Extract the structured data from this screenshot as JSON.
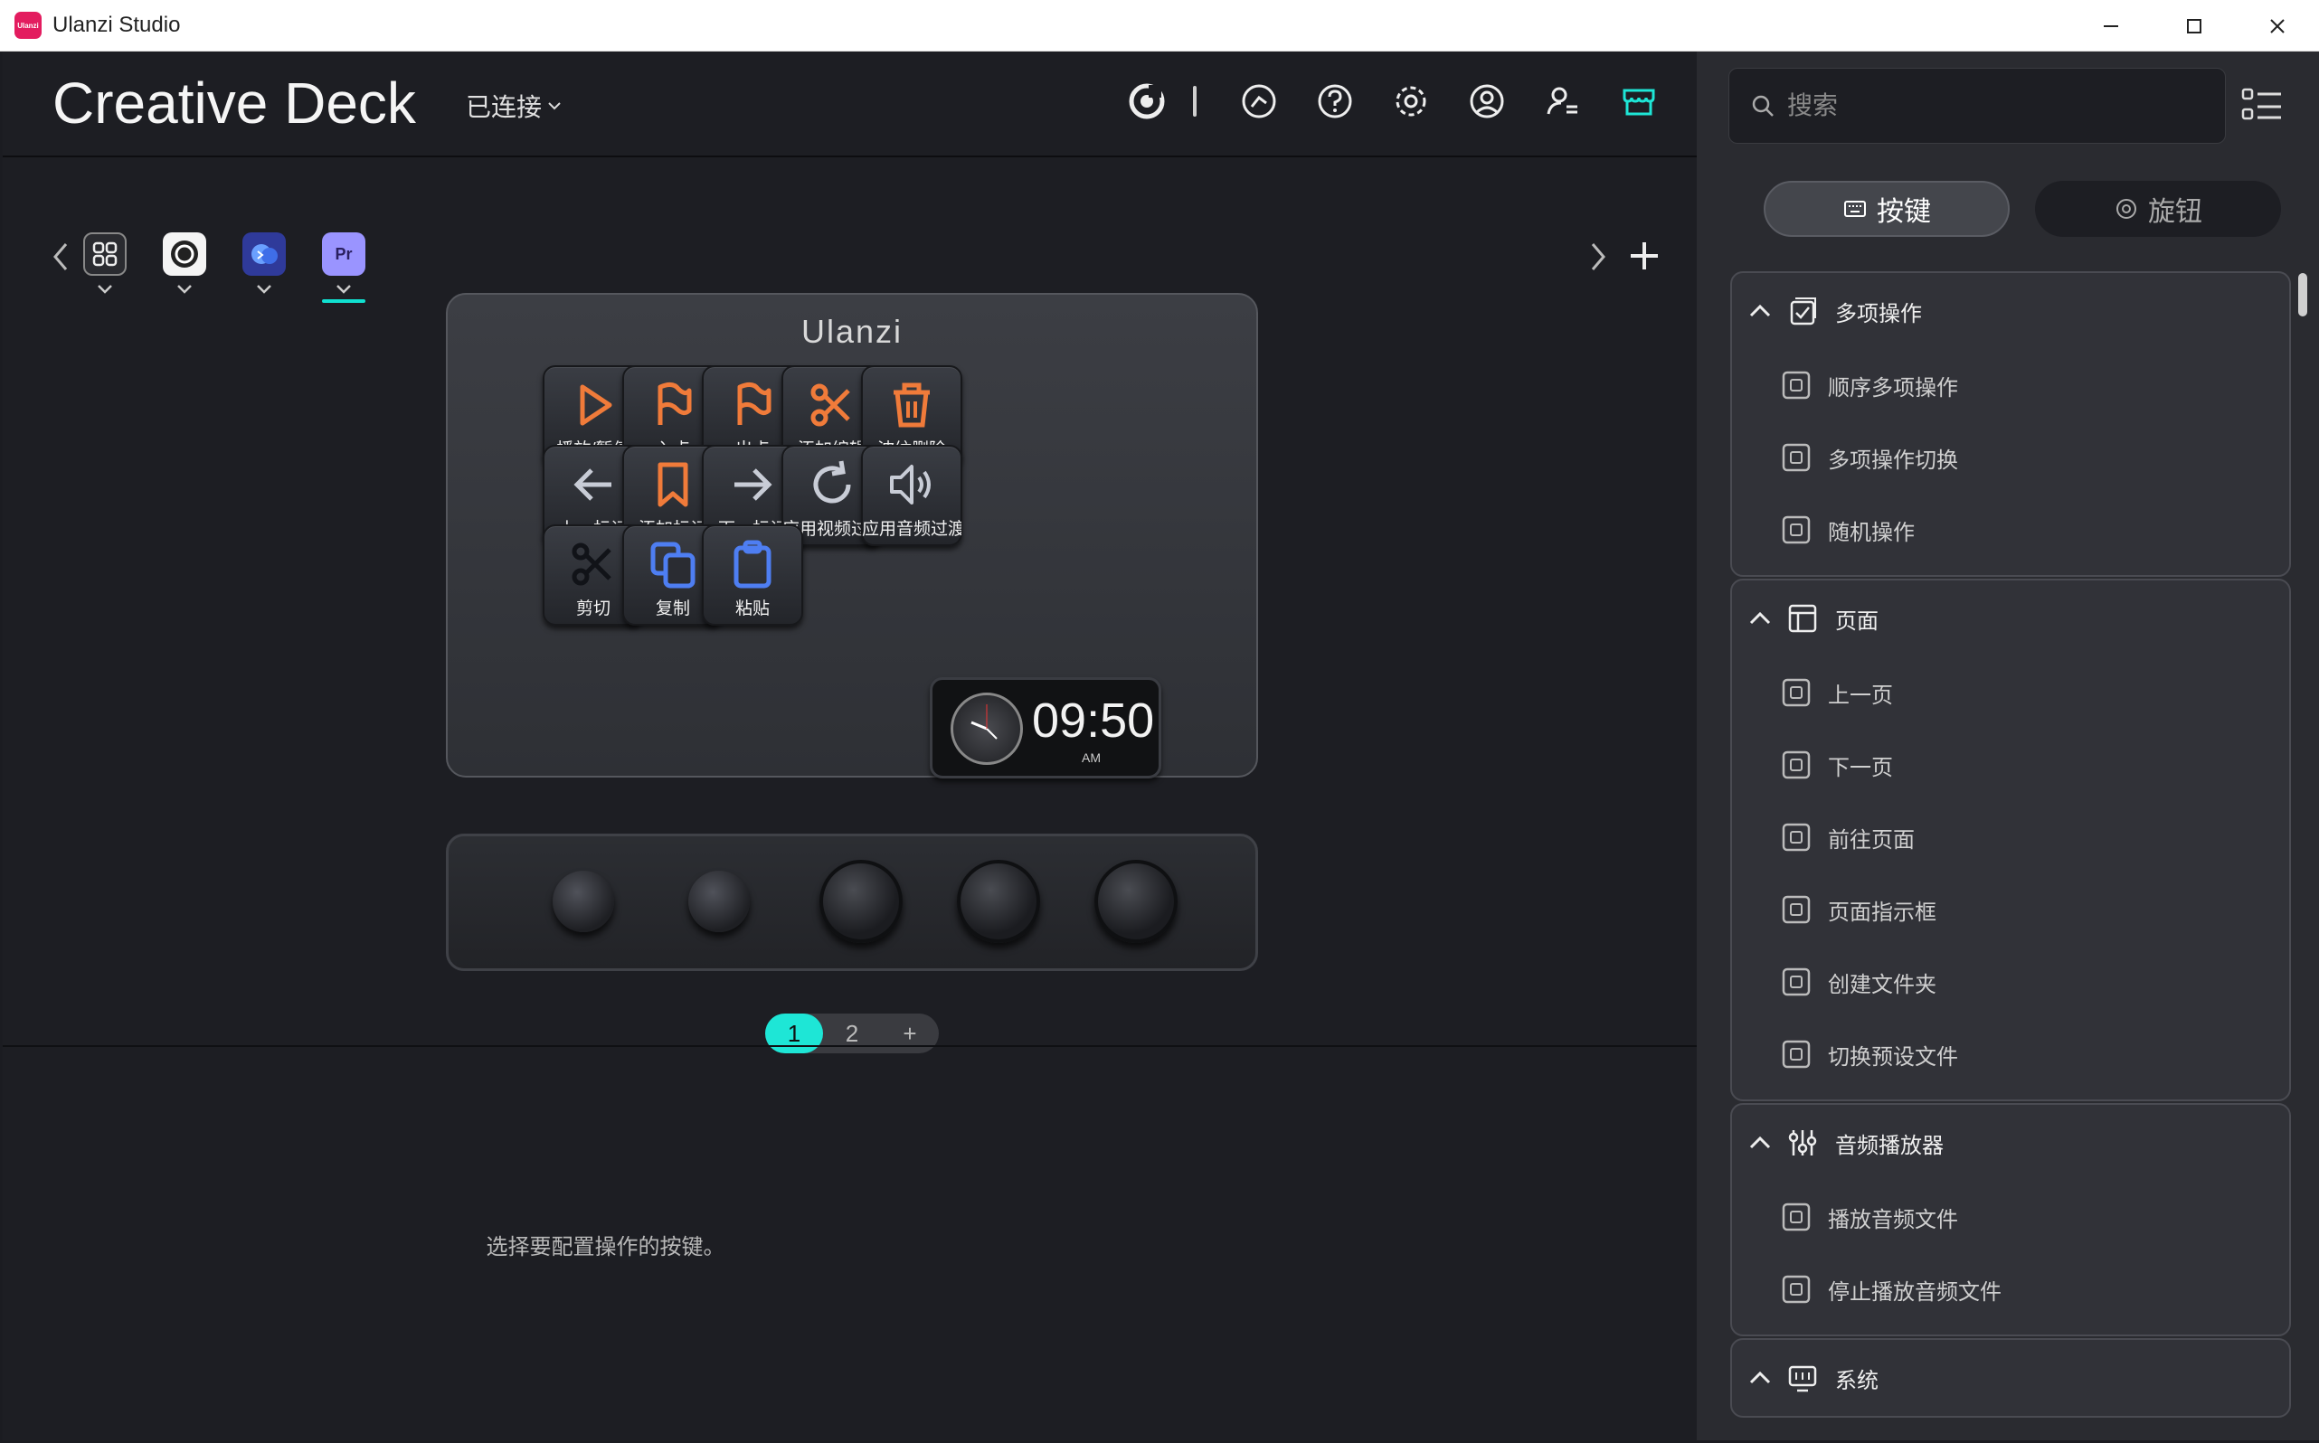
{
  "window": {
    "title": "Ulanzi Studio",
    "logo_text": "Ulanzi"
  },
  "header": {
    "device_name": "Creative Deck",
    "connection_status": "已连接"
  },
  "deck": {
    "brand": "Ulanzi",
    "keys": [
      {
        "label": "播放/暂停",
        "icon": "play-icon",
        "color": "#f07b3a"
      },
      {
        "label": "入点",
        "icon": "flag-icon",
        "color": "#f07b3a"
      },
      {
        "label": "出点",
        "icon": "flag-icon",
        "color": "#f07b3a"
      },
      {
        "label": "添加编辑",
        "icon": "scissors-icon",
        "color": "#f07b3a"
      },
      {
        "label": "波纹删除",
        "icon": "trash-icon",
        "color": "#f07b3a"
      },
      {
        "label": "上一标记",
        "icon": "arrow-left-icon",
        "color": "#c8ccd6"
      },
      {
        "label": "添加标记",
        "icon": "bookmark-icon",
        "color": "#f07b3a"
      },
      {
        "label": "下一标记",
        "icon": "arrow-right-icon",
        "color": "#c8ccd6"
      },
      {
        "label": "应用视频过渡",
        "icon": "refresh-icon",
        "color": "#c8ccd6"
      },
      {
        "label": "应用音频过渡",
        "icon": "speaker-icon",
        "color": "#c8ccd6"
      },
      {
        "label": "剪切",
        "icon": "scissors-icon",
        "color": "#111318"
      },
      {
        "label": "复制",
        "icon": "copy-icon",
        "color": "#4e7ef2"
      },
      {
        "label": "粘贴",
        "icon": "clipboard-icon",
        "color": "#4e7ef2"
      }
    ],
    "clock": {
      "time": "09:50",
      "ampm": "AM"
    }
  },
  "pagination": {
    "pages": [
      "1",
      "2"
    ],
    "add": "+",
    "active": "1"
  },
  "hint": "选择要配置操作的按键。",
  "sidebar": {
    "search_placeholder": "搜索",
    "tabs": [
      {
        "label": "按键"
      },
      {
        "label": "旋钮"
      }
    ],
    "groups": [
      {
        "title": "多项操作",
        "icon": "checklist-icon",
        "items": [
          "顺序多项操作",
          "多项操作切换",
          "随机操作"
        ]
      },
      {
        "title": "页面",
        "icon": "layout-icon",
        "items": [
          "上一页",
          "下一页",
          "前往页面",
          "页面指示框",
          "创建文件夹",
          "切换预设文件"
        ]
      },
      {
        "title": "音频播放器",
        "icon": "sliders-icon",
        "items": [
          "播放音频文件",
          "停止播放音频文件"
        ]
      },
      {
        "title": "系统",
        "icon": "monitor-icon",
        "items": []
      }
    ]
  },
  "colors": {
    "accent": "#1ee6d6",
    "orange": "#f07b3a",
    "blue": "#4e7ef2"
  }
}
